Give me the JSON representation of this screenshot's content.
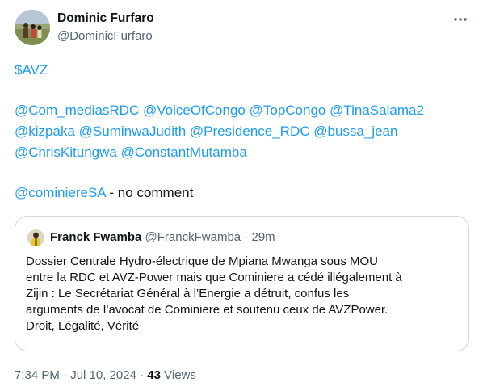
{
  "author": {
    "name": "Dominic Furfaro",
    "handle": "@DominicFurfaro"
  },
  "more_icon": "more-horizontal-icon",
  "tweet": {
    "cashtag": "$AVZ",
    "mentions": [
      [
        "@Com_mediasRDC",
        "@VoiceOfCongo",
        "@TopCongo",
        "@TinaSalama2"
      ],
      [
        "@kizpaka",
        "@SuminwaJudith",
        "@Presidence_RDC",
        "@bussa_jean"
      ],
      [
        "@ChrisKitungwa",
        "@ConstantMutamba"
      ]
    ],
    "reply_mention": "@cominiereSA",
    "reply_text": " - no comment"
  },
  "quote": {
    "name": "Franck Fwamba",
    "handle": "@FranckFwamba",
    "separator": " · ",
    "time": "29m",
    "lines": [
      "Dossier Centrale Hydro-électrique de Mpiana Mwanga sous MOU",
      "entre la RDC et AVZ-Power mais que Cominiere a cédé illégalement à",
      "Zijin : Le Secrétariat Général à l’Energie a détruit, confus les",
      "arguments de l’avocat de Cominiere et soutenu ceux de AVZPower.",
      "Droit, Légalité, Vérité"
    ]
  },
  "footer": {
    "time": "7:34 PM",
    "dot": " · ",
    "date": "Jul 10, 2024",
    "views_count": "43",
    "views_label": " Views"
  },
  "colors": {
    "link": "#1d9bf0",
    "text": "#0f1419",
    "secondary": "#536471",
    "border": "#cfd9de"
  }
}
